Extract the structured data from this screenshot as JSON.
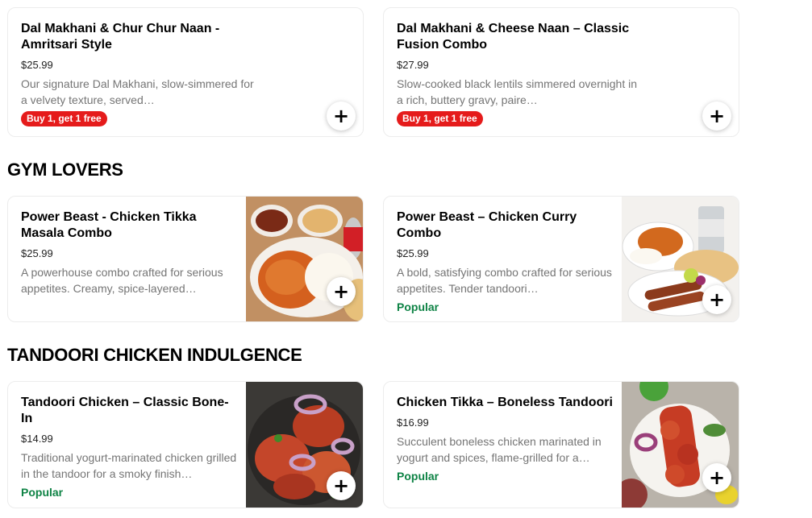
{
  "sections": [
    {
      "items": [
        {
          "title": "Dal Makhani & Chur Chur Naan - Amritsari Style",
          "price": "$25.99",
          "description": "Our signature Dal Makhani, slow-simmered for a velvety texture, served…",
          "tag": "Buy 1, get 1 free",
          "add_icon": "plus-icon"
        },
        {
          "title": "Dal Makhani & Cheese Naan – Classic Fusion Combo",
          "price": "$27.99",
          "description": "Slow-cooked black lentils simmered overnight in a rich, buttery gravy, paire…",
          "tag": "Buy 1, get 1 free",
          "add_icon": "plus-icon"
        }
      ]
    },
    {
      "title": "GYM LOVERS",
      "items": [
        {
          "title": "Power Beast - Chicken Tikka Masala Combo",
          "price": "$25.99",
          "description": "A powerhouse combo crafted for serious appetites. Creamy, spice-layered…",
          "tag": "",
          "add_icon": "plus-icon"
        },
        {
          "title": "Power Beast – Chicken Curry Combo",
          "price": "$25.99",
          "description": "A bold, satisfying combo crafted for serious appetites. Tender tandoori…",
          "tag": "Popular",
          "add_icon": "plus-icon"
        }
      ]
    },
    {
      "title": "TANDOORI CHICKEN INDULGENCE",
      "items": [
        {
          "title": "Tandoori Chicken – Classic Bone-In",
          "price": "$14.99",
          "description": "Traditional yogurt-marinated chicken grilled in the tandoor for a smoky finish…",
          "tag": "Popular",
          "add_icon": "plus-icon"
        },
        {
          "title": "Chicken Tikka – Boneless Tandoori",
          "price": "$16.99",
          "description": "Succulent boneless chicken marinated in yogurt and spices, flame-grilled for a…",
          "tag": "Popular",
          "add_icon": "plus-icon"
        }
      ]
    }
  ],
  "add_label": "+",
  "colors": {
    "promo": "#e51b1b",
    "popular": "#0e8345",
    "text_muted": "#757575"
  }
}
